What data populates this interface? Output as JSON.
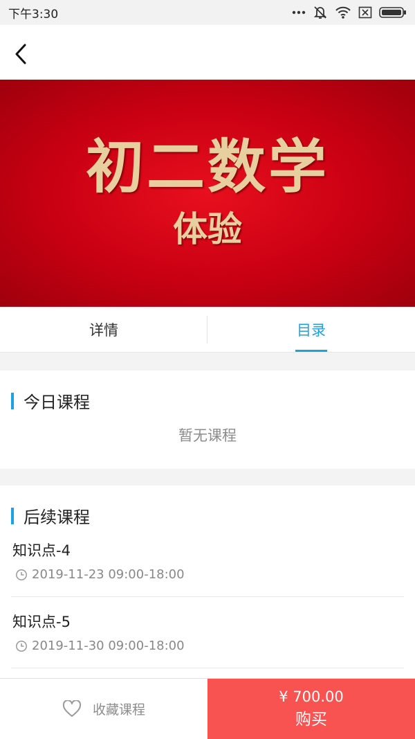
{
  "status_bar": {
    "time": "下午3:30",
    "icons": [
      "more-dots-icon",
      "mute-icon",
      "wifi-icon",
      "sim-card-icon",
      "battery-icon"
    ]
  },
  "nav": {
    "back_icon": "chevron-left-icon"
  },
  "banner": {
    "title": "初二数学",
    "subtitle": "体验",
    "colors": {
      "background": "#d5001a",
      "text": "#e7cfa0"
    }
  },
  "tabs": [
    {
      "label": "详情",
      "active": false
    },
    {
      "label": "目录",
      "active": true
    }
  ],
  "today": {
    "title": "今日课程",
    "empty_text": "暂无课程"
  },
  "upcoming": {
    "title": "后续课程",
    "items": [
      {
        "name": "知识点-4",
        "time": "2019-11-23 09:00-18:00"
      },
      {
        "name": "知识点-5",
        "time": "2019-11-30 09:00-18:00"
      }
    ]
  },
  "bottom_bar": {
    "favorite_icon": "heart-icon",
    "favorite_label": "收藏课程",
    "price": "¥ 700.00",
    "buy_label": "购买"
  },
  "colors": {
    "accent": "#1da1e0",
    "buy_button": "#f85350"
  }
}
